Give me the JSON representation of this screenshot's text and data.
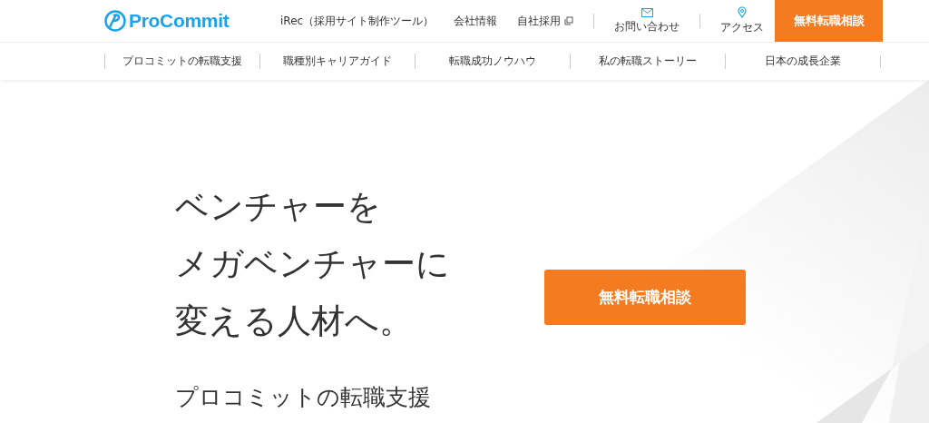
{
  "header": {
    "logo": "ProCommit",
    "links": [
      {
        "label": "iRec（採用サイト制作ツール）",
        "kind": "text"
      },
      {
        "label": "会社情報",
        "kind": "text"
      },
      {
        "label": "自社採用",
        "kind": "external"
      }
    ],
    "icon_links": [
      {
        "label": "お問い合わせ",
        "kind": "mail"
      },
      {
        "label": "アクセス",
        "kind": "pin"
      }
    ],
    "cta": "無料転職相談"
  },
  "nav": [
    "プロコミットの転職支援",
    "職種別キャリアガイド",
    "転職成功ノウハウ",
    "私の転職ストーリー",
    "日本の成長企業"
  ],
  "hero": {
    "headline": [
      "ベンチャーを",
      "メガベンチャーに",
      "変える人材へ。"
    ],
    "cta": "無料転職相談",
    "subtitle": "プロコミットの転職支援"
  }
}
